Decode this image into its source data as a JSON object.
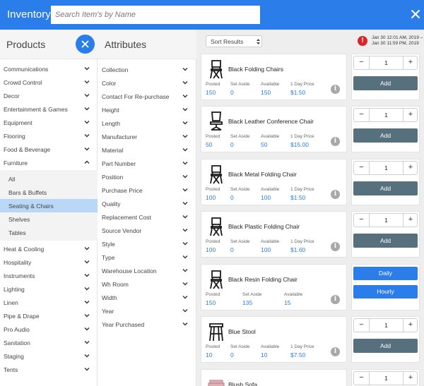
{
  "header": {
    "title": "Inventory",
    "search_placeholder": "Search Item's by Name",
    "close_icon": "close-icon"
  },
  "products": {
    "title": "Products",
    "clear_icon": "close-icon",
    "categories": [
      {
        "label": "Communications",
        "expanded": false
      },
      {
        "label": "Crowd Control",
        "expanded": false
      },
      {
        "label": "Decor",
        "expanded": false
      },
      {
        "label": "Entertainment & Games",
        "expanded": false
      },
      {
        "label": "Equipment",
        "expanded": false
      },
      {
        "label": "Flooring",
        "expanded": false
      },
      {
        "label": "Food & Beverage",
        "expanded": false
      },
      {
        "label": "Furniture",
        "expanded": true
      },
      {
        "label": "Heat & Cooling",
        "expanded": false
      },
      {
        "label": "Hospitality",
        "expanded": false
      },
      {
        "label": "Instruments",
        "expanded": false
      },
      {
        "label": "Lighting",
        "expanded": false
      },
      {
        "label": "Linen",
        "expanded": false
      },
      {
        "label": "Pipe & Drape",
        "expanded": false
      },
      {
        "label": "Pro Audio",
        "expanded": false
      },
      {
        "label": "Sanitation",
        "expanded": false
      },
      {
        "label": "Staging",
        "expanded": false
      },
      {
        "label": "Tents",
        "expanded": false
      }
    ],
    "furniture_sub": [
      {
        "label": "All",
        "selected": false
      },
      {
        "label": "Bars & Buffets",
        "selected": false
      },
      {
        "label": "Seating & Chairs",
        "selected": true
      },
      {
        "label": "Shelves",
        "selected": false
      },
      {
        "label": "Tables",
        "selected": false
      }
    ]
  },
  "attributes": {
    "title": "Attributes",
    "items": [
      "Collection",
      "Color",
      "Contact For Re-purchase",
      "Height",
      "Length",
      "Manufacturer",
      "Material",
      "Part Number",
      "Position",
      "Purchase Price",
      "Quality",
      "Replacement Cost",
      "Source Vendor",
      "Style",
      "Type",
      "Warehouse Location",
      "Wh Room",
      "Width",
      "Year",
      "Year Purchased"
    ]
  },
  "results": {
    "sort_label": "Sort Results",
    "date_range_line1": "Jan 30 12:01 AM, 2019 –",
    "date_range_line2": "Jan 30 11:59 PM, 2019",
    "alert_glyph": "!",
    "stat_labels": {
      "posted": "Posted",
      "set_aside": "Set Aside",
      "available": "Available",
      "day_price": "1 Day Price"
    },
    "add_label": "Add",
    "daily_label": "Daily",
    "hourly_label": "Hourly",
    "minus_glyph": "−",
    "plus_glyph": "+",
    "info_glyph": "i",
    "items": [
      {
        "name": "Black Folding Chairs",
        "posted": "150",
        "set_aside": "0",
        "available": "150",
        "price": "$1.50",
        "qty": "1",
        "mode": "add",
        "icon": "folding-chair-icon"
      },
      {
        "name": "Black Leather Conference Chair",
        "posted": "50",
        "set_aside": "0",
        "available": "50",
        "price": "$15.00",
        "qty": "1",
        "mode": "add",
        "icon": "office-chair-icon"
      },
      {
        "name": "Black Metal Folding Chair",
        "posted": "100",
        "set_aside": "0",
        "available": "100",
        "price": "$1.50",
        "qty": "1",
        "mode": "add",
        "icon": "folding-chair-icon"
      },
      {
        "name": "Black Plastic Folding Chair",
        "posted": "100",
        "set_aside": "0",
        "available": "100",
        "price": "$1.60",
        "qty": "1",
        "mode": "add",
        "icon": "folding-chair-icon"
      },
      {
        "name": "Black Resin Folding Chair",
        "posted": "150",
        "set_aside": "135",
        "available": "15",
        "price": "",
        "qty": "",
        "mode": "rate",
        "icon": "folding-chair-icon"
      },
      {
        "name": "Blue Stool",
        "posted": "10",
        "set_aside": "0",
        "available": "10",
        "price": "$7.50",
        "qty": "1",
        "mode": "add",
        "icon": "stool-icon"
      },
      {
        "name": "Blush Sofa",
        "posted": "",
        "set_aside": "",
        "available": "",
        "price": "",
        "qty": "1",
        "mode": "add",
        "icon": "sofa-icon"
      }
    ]
  }
}
